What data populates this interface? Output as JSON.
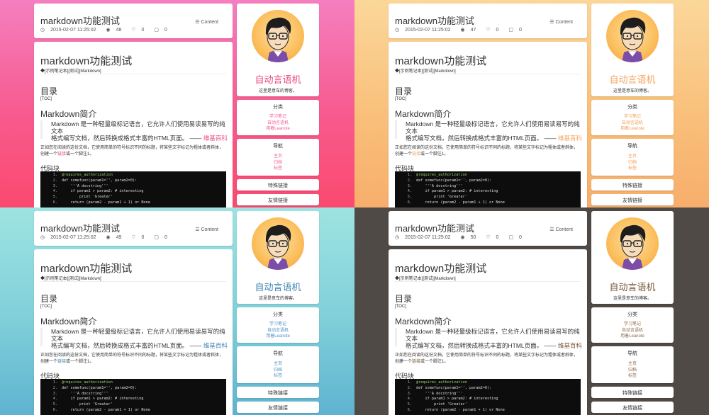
{
  "header": {
    "title": "markdown功能测试",
    "date": "2015-02-07 11:25:02",
    "likes": "0",
    "comments": "0",
    "toc_label": "Content"
  },
  "views": [
    "48",
    "47",
    "49",
    "50"
  ],
  "article": {
    "title": "markdown功能测试",
    "tags": "[示例笔记本][测试][Markdown]",
    "h2_toc": "目录",
    "toc_placeholder": "[TOC]",
    "h2_intro": "Markdown简介",
    "quote_line1": "Markdown 是一种轻量级标记语言，它允许人们使用易读易写的纯文本",
    "quote_line2": "格式编写文档，然后转换成格式丰富的HTML页面。",
    "quote_dash": "——",
    "quote_link": "维基百科",
    "para_line1": "正如您在阅读的这份文档，它使用简单的符号标识不同的标题，将某些文字标记为粗体或者斜体，",
    "para_line2_a": "创建一个",
    "para_line2_link": "链接",
    "para_line2_b": "或一个脚注1。",
    "h3_code": "代码块",
    "code": [
      {
        "n": "1.",
        "text": "@requires_authorization"
      },
      {
        "n": "2.",
        "text": "def somefunc(param1='', param2=0):"
      },
      {
        "n": "3.",
        "text": "    '''A docstring'''"
      },
      {
        "n": "4.",
        "text": "    if param1 > param2: # interesting"
      },
      {
        "n": "5.",
        "text": "        print 'Greater'"
      },
      {
        "n": "6.",
        "text": "    return (param2 - param1 + 1) or None"
      }
    ]
  },
  "profile": {
    "name": "自动言语机",
    "desc": "这里是意车的博客。"
  },
  "categories": {
    "title": "分类",
    "items": [
      "学习笔记",
      "自动言语机",
      "用着Leanote"
    ]
  },
  "nav": {
    "title": "导航",
    "items": [
      "主页",
      "归档",
      "标签"
    ]
  },
  "special": {
    "title": "特殊链接"
  },
  "friends": {
    "title": "友情链接"
  },
  "themes": [
    {
      "accent": "#e84a82",
      "nav": "#f35c95"
    },
    {
      "accent": "#f7a35c",
      "nav": "#f4a05a"
    },
    {
      "accent": "#3e86b3",
      "nav": "#4c8fc1"
    },
    {
      "accent": "#7a5a3c",
      "nav": "#8b6a4a"
    }
  ]
}
